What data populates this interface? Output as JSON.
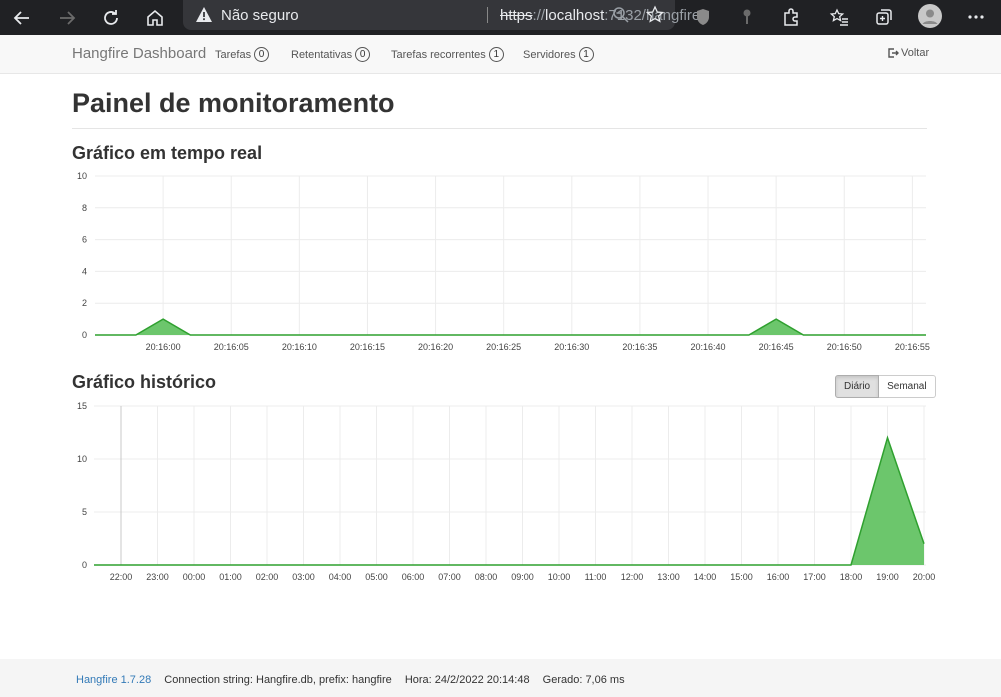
{
  "browser": {
    "security_label": "Não seguro",
    "url_protocol": "https",
    "url_separator": "://",
    "url_host": "localhost",
    "url_rest": ":7132/hangfire"
  },
  "navbar": {
    "brand": "Hangfire Dashboard",
    "items": [
      {
        "label": "Tarefas",
        "count": "0"
      },
      {
        "label": "Retentativas",
        "count": "0"
      },
      {
        "label": "Tarefas recorrentes",
        "count": "1"
      },
      {
        "label": "Servidores",
        "count": "1"
      }
    ],
    "back_label": "Voltar"
  },
  "page": {
    "title": "Painel de monitoramento",
    "realtime_title": "Gráfico em tempo real",
    "history_title": "Gráfico histórico",
    "period_buttons": {
      "daily": "Diário",
      "weekly": "Semanal"
    }
  },
  "chart_data": [
    {
      "type": "area",
      "title": "Gráfico em tempo real",
      "x": [
        "20:16:00",
        "20:16:05",
        "20:16:10",
        "20:16:15",
        "20:16:20",
        "20:16:25",
        "20:16:30",
        "20:16:35",
        "20:16:40",
        "20:16:45",
        "20:16:50",
        "20:16:55"
      ],
      "points": [
        {
          "t": "20:15:55",
          "v": 0
        },
        {
          "t": "20:15:58",
          "v": 0
        },
        {
          "t": "20:16:00",
          "v": 1
        },
        {
          "t": "20:16:02",
          "v": 0
        },
        {
          "t": "20:16:43",
          "v": 0
        },
        {
          "t": "20:16:45",
          "v": 1
        },
        {
          "t": "20:16:47",
          "v": 0
        },
        {
          "t": "20:16:56",
          "v": 0
        }
      ],
      "yticks": [
        0,
        2,
        4,
        6,
        8,
        10
      ],
      "ylim": [
        0,
        10
      ],
      "grid": true,
      "colors": {
        "fill": "#6cc66c",
        "line": "#2fa02f"
      }
    },
    {
      "type": "area",
      "title": "Gráfico histórico",
      "categories": [
        "22:00",
        "23:00",
        "00:00",
        "01:00",
        "02:00",
        "03:00",
        "04:00",
        "05:00",
        "06:00",
        "07:00",
        "08:00",
        "09:00",
        "10:00",
        "11:00",
        "12:00",
        "13:00",
        "14:00",
        "15:00",
        "16:00",
        "17:00",
        "18:00",
        "19:00",
        "20:00"
      ],
      "values": [
        0,
        0,
        0,
        0,
        0,
        0,
        0,
        0,
        0,
        0,
        0,
        0,
        0,
        0,
        0,
        0,
        0,
        0,
        0,
        0,
        0,
        12,
        2
      ],
      "yticks": [
        0,
        5,
        10,
        15
      ],
      "ylim": [
        0,
        15
      ],
      "grid": true,
      "colors": {
        "fill": "#6cc66c",
        "line": "#2fa02f"
      }
    }
  ],
  "footer": {
    "version": "Hangfire 1.7.28",
    "connection": "Connection string: Hangfire.db, prefix: hangfire",
    "time": "Hora: 24/2/2022 20:14:48",
    "generated": "Gerado: 7,06 ms"
  }
}
